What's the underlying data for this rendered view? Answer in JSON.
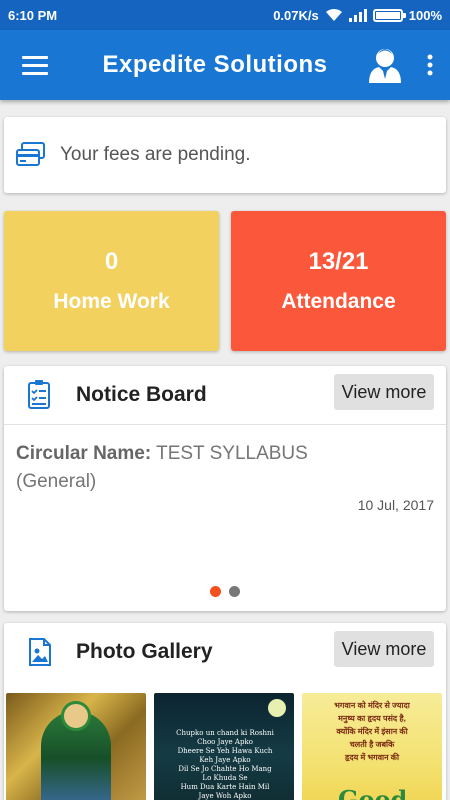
{
  "status_bar": {
    "time": "6:10 PM",
    "speed": "0.07K/s",
    "battery_percent": "100%",
    "battery_level": 1.0
  },
  "app_bar": {
    "title": "Expedite Solutions",
    "menu_icon": "hamburger-menu-icon",
    "profile_icon": "user-profile-icon",
    "more_icon": "more-vert-icon"
  },
  "fees_banner": {
    "icon": "credit-card-icon",
    "text": "Your fees are pending."
  },
  "tiles": {
    "homework": {
      "count": "0",
      "label": "Home Work",
      "color": "#f2d15e"
    },
    "attendance": {
      "count": "13/21",
      "label": "Attendance",
      "color": "#fa573b"
    }
  },
  "notice_board": {
    "title": "Notice Board",
    "view_more": "View more",
    "circular_label": "Circular Name:",
    "circular_name": "TEST SYLLABUS",
    "circular_category": "(General)",
    "date": "10 Jul, 2017",
    "pager": {
      "count": 2,
      "active_index": 0
    }
  },
  "photo_gallery": {
    "title": "Photo Gallery",
    "view_more": "View more",
    "thumbs": [
      {
        "name": "gallery-photo-1"
      },
      {
        "name": "gallery-photo-2",
        "lines": [
          "Chupko un chand ki Roshni",
          "Choo Jaye Apko",
          "Dheere Se Yeh Hawa Kuch",
          "Keh Jaye Apko",
          "Dil Se Jo Chahte Ho Mang",
          "Lo Khuda Se",
          "Hum Dua Karte Hain Mil",
          "Jaye Woh Apko"
        ]
      },
      {
        "name": "gallery-photo-3",
        "lines": [
          "भगवान को मंदिर से ज्यादा",
          "मनुष्य का हृदय पसंद है,",
          "क्योंकि मंदिर में इंसान की",
          "चलती है जबकि",
          "हृदय में भगवान की"
        ],
        "big_text": "Good"
      }
    ]
  },
  "colors": {
    "status_bar": "#1565c0",
    "app_bar": "#1976d2",
    "accent_dot": "#f4511e"
  }
}
